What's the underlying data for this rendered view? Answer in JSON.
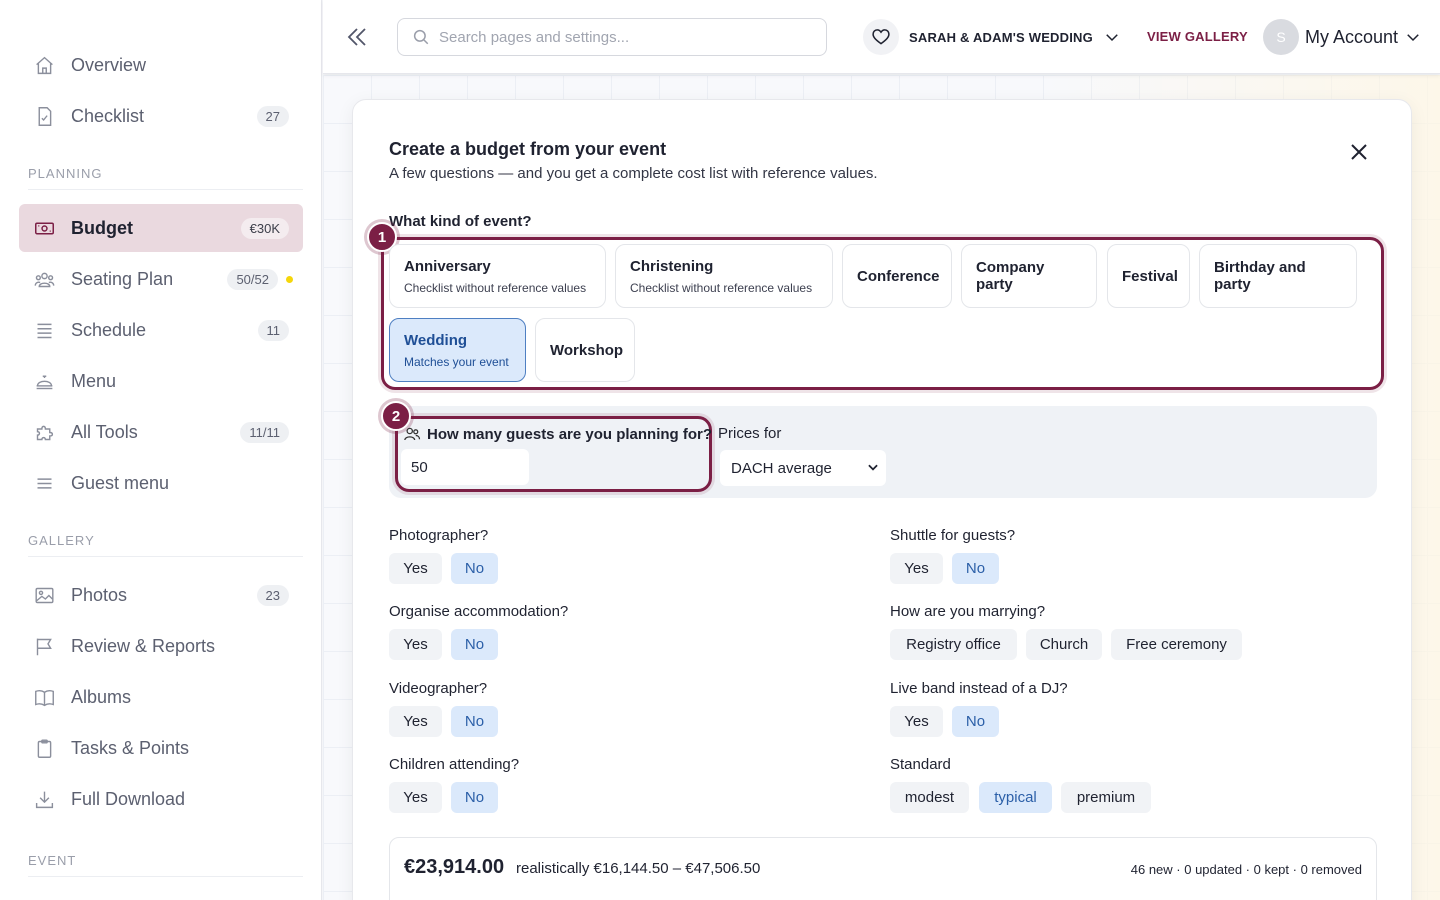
{
  "sidebar": {
    "top_items": [
      {
        "label": "Overview",
        "badge": ""
      },
      {
        "label": "Checklist",
        "badge": "27"
      }
    ],
    "planning_title": "PLANNING",
    "planning_items": [
      {
        "label": "Budget",
        "badge": "€30K"
      },
      {
        "label": "Seating Plan",
        "badge": "50/52"
      },
      {
        "label": "Schedule",
        "badge": "11"
      },
      {
        "label": "Menu",
        "badge": ""
      },
      {
        "label": "All Tools",
        "badge": "11/11"
      },
      {
        "label": "Guest menu",
        "badge": ""
      }
    ],
    "gallery_title": "GALLERY",
    "gallery_items": [
      {
        "label": "Photos",
        "badge": "23"
      },
      {
        "label": "Review & Reports",
        "badge": ""
      },
      {
        "label": "Albums",
        "badge": ""
      },
      {
        "label": "Tasks & Points",
        "badge": ""
      },
      {
        "label": "Full Download",
        "badge": ""
      }
    ],
    "event_title": "EVENT"
  },
  "header": {
    "search_placeholder": "Search pages and settings...",
    "event_name": "SARAH & ADAM'S WEDDING",
    "view_gallery": "VIEW GALLERY",
    "avatar_initial": "S",
    "account_label": "My Account"
  },
  "modal": {
    "title": "Create a budget from your event",
    "subtitle": "A few questions — and you get a complete cost list with reference values.",
    "kind_question": "What kind of event?",
    "step1": "1",
    "step2": "2",
    "event_types": [
      {
        "title": "Anniversary",
        "sub": "Checklist without reference values"
      },
      {
        "title": "Christening",
        "sub": "Checklist without reference values"
      },
      {
        "title": "Conference",
        "sub": ""
      },
      {
        "title": "Company party",
        "sub": ""
      },
      {
        "title": "Festival",
        "sub": ""
      },
      {
        "title": "Birthday and party",
        "sub": ""
      },
      {
        "title": "Wedding",
        "sub": "Matches your event",
        "selected": true
      },
      {
        "title": "Workshop",
        "sub": ""
      }
    ],
    "guests_question": "How many guests are you planning for?",
    "guests_value": "50",
    "prices_label": "Prices for",
    "prices_value": "DACH average",
    "questions": {
      "photographer": {
        "label": "Photographer?",
        "yes": "Yes",
        "no": "No",
        "selected": "No"
      },
      "shuttle": {
        "label": "Shuttle for guests?",
        "yes": "Yes",
        "no": "No",
        "selected": "No"
      },
      "accommodation": {
        "label": "Organise accommodation?",
        "yes": "Yes",
        "no": "No",
        "selected": "No"
      },
      "marrying": {
        "label": "How are you marrying?",
        "options": [
          "Registry office",
          "Church",
          "Free ceremony"
        ]
      },
      "videographer": {
        "label": "Videographer?",
        "yes": "Yes",
        "no": "No",
        "selected": "No"
      },
      "liveband": {
        "label": "Live band instead of a DJ?",
        "yes": "Yes",
        "no": "No",
        "selected": "No"
      },
      "children": {
        "label": "Children attending?",
        "yes": "Yes",
        "no": "No",
        "selected": "No"
      },
      "standard": {
        "label": "Standard",
        "options": [
          "modest",
          "typical",
          "premium"
        ],
        "selected": "typical"
      }
    },
    "summary": {
      "total": "€23,914.00",
      "range": "realistically €16,144.50 – €47,506.50",
      "stats": "46 new · 0 updated · 0 kept · 0 removed"
    }
  },
  "colors": {
    "accent": "#7b1f45",
    "selected_bg": "#dbe9fb",
    "selected_text": "#2b5fa8",
    "status_dot": "#f5d60a"
  }
}
